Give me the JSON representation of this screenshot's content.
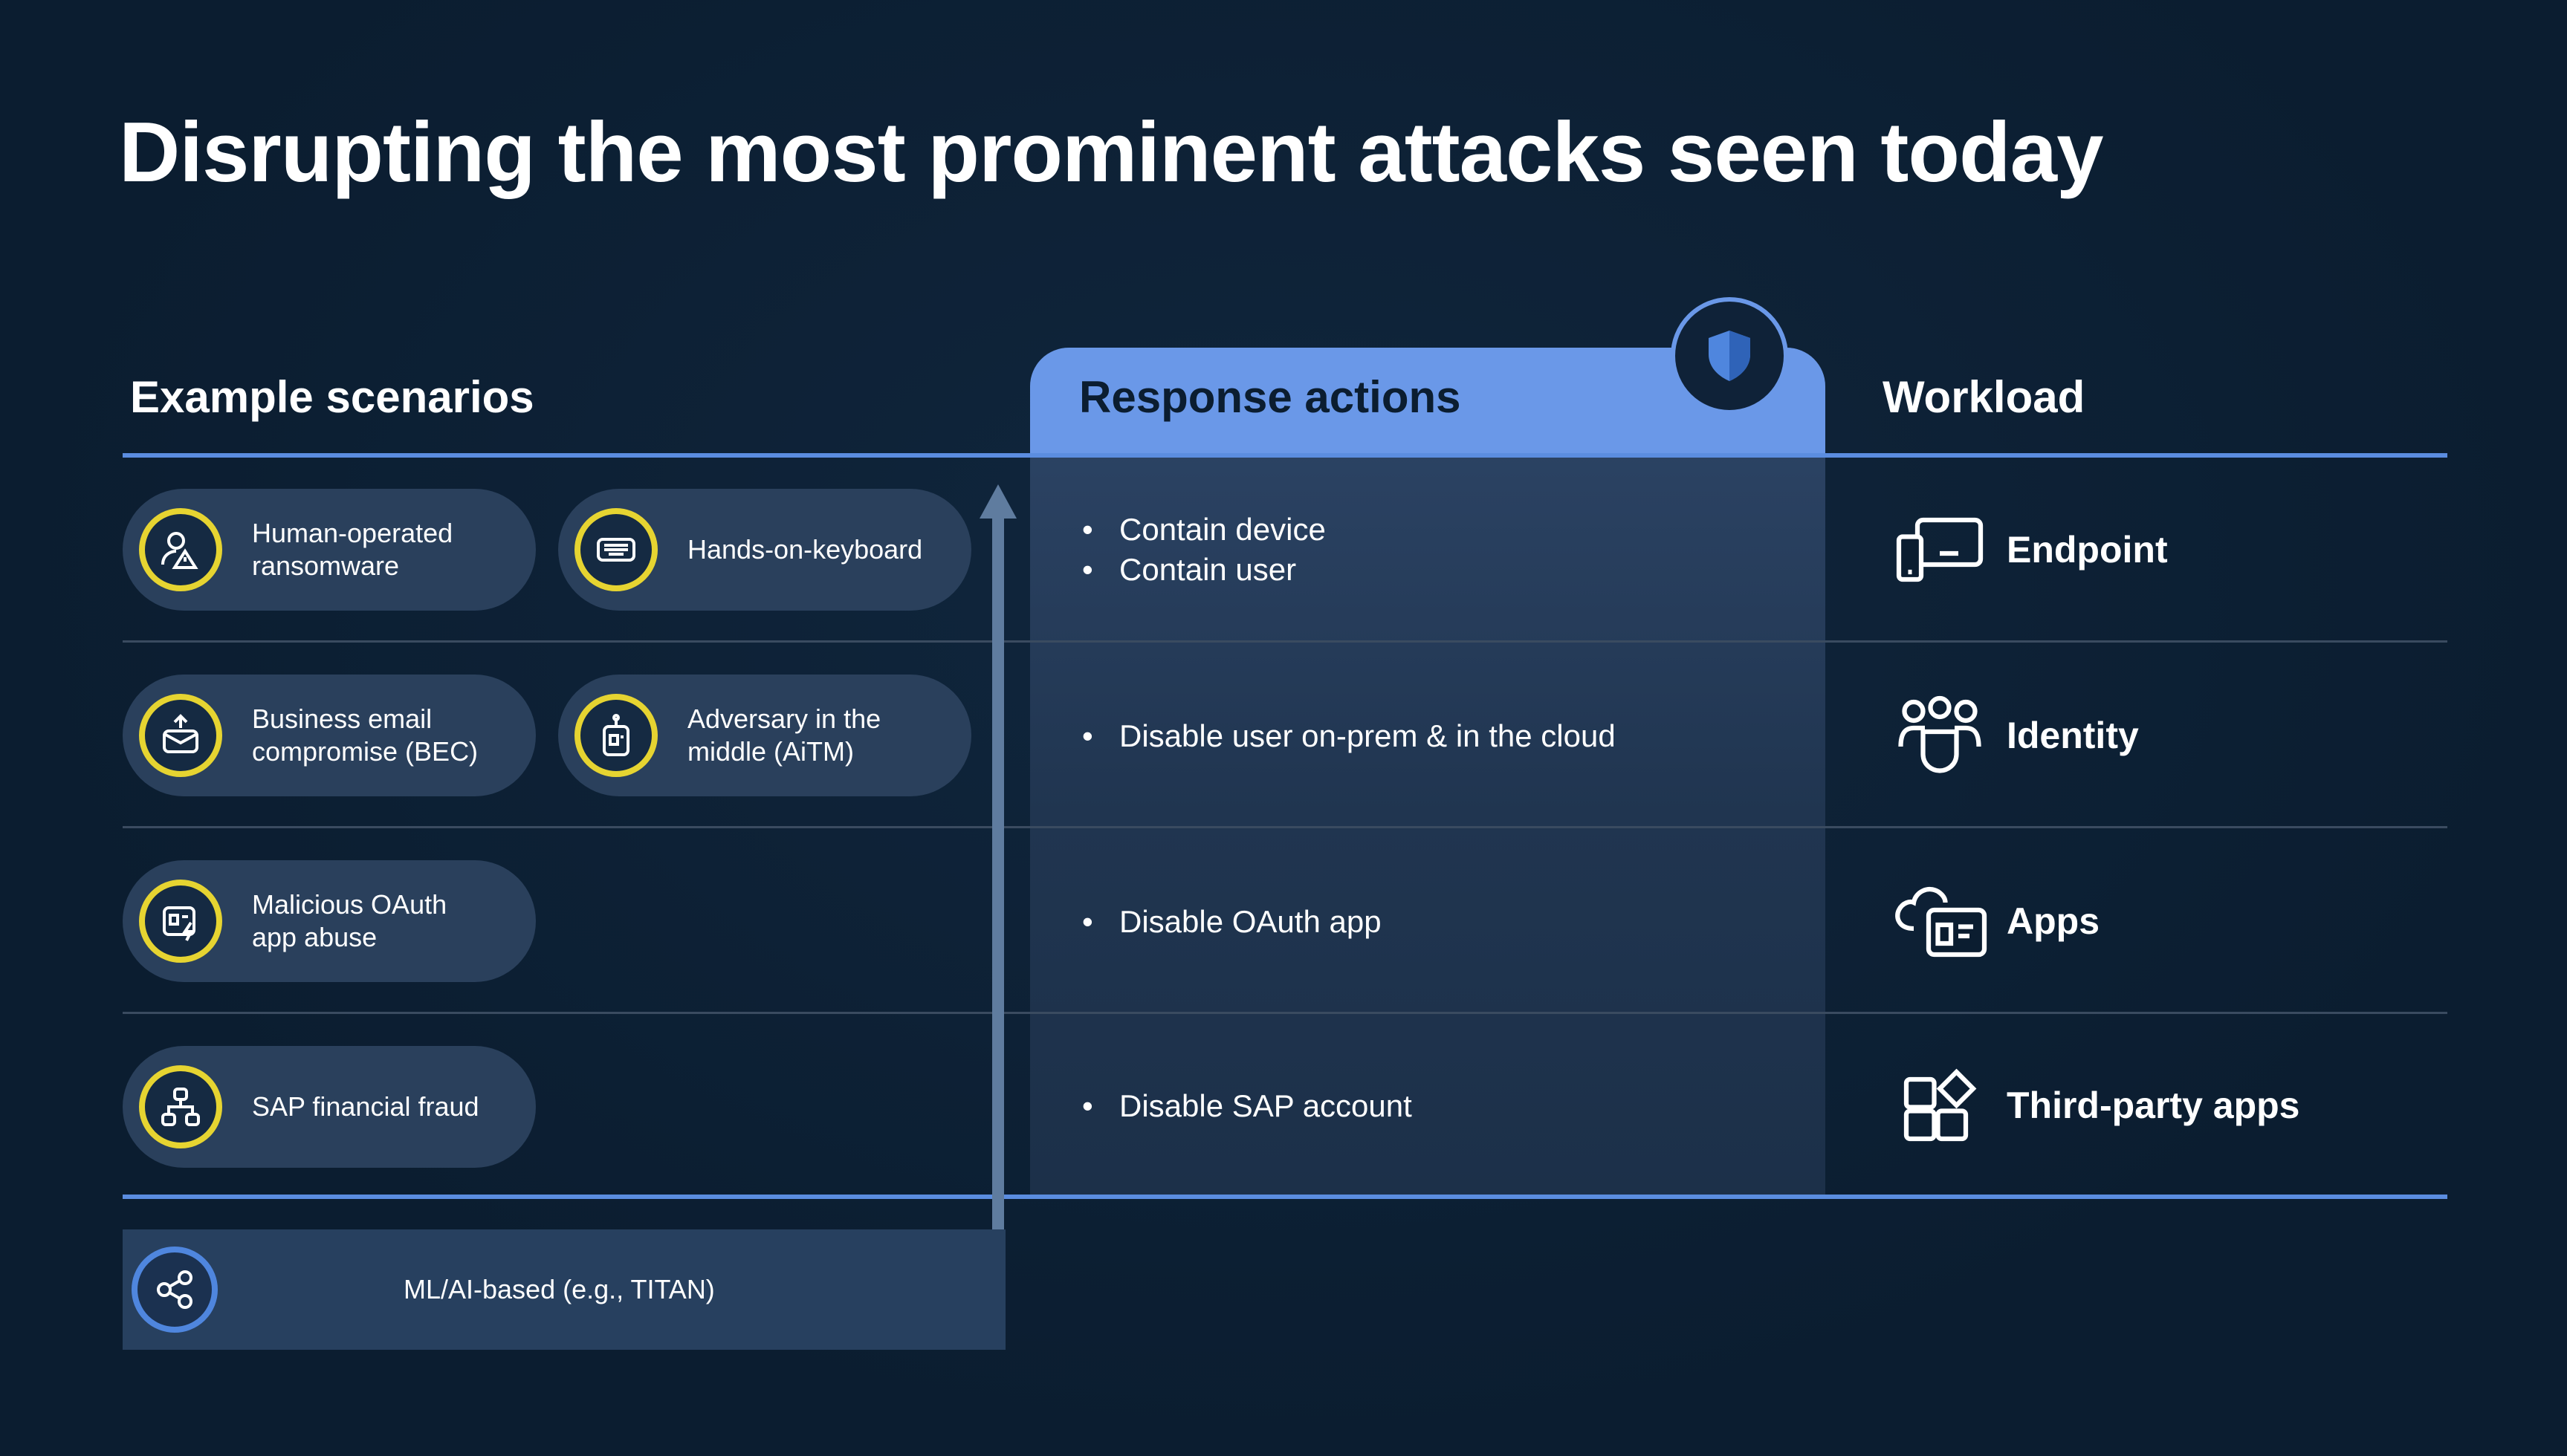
{
  "title": "Disrupting the most prominent attacks seen today",
  "columns": {
    "scenarios": "Example scenarios",
    "response": "Response actions",
    "workload": "Workload"
  },
  "scenarios": [
    {
      "label": "Human-operated ransomware",
      "icon": "user-warning-icon"
    },
    {
      "label": "Hands-on-keyboard",
      "icon": "keyboard-icon"
    },
    {
      "label": "Business email compromise (BEC)",
      "icon": "email-upload-icon"
    },
    {
      "label": "Adversary in the middle (AiTM)",
      "icon": "id-badge-icon"
    },
    {
      "label": "Malicious OAuth app abuse",
      "icon": "app-flash-icon"
    },
    {
      "label": "SAP financial fraud",
      "icon": "flow-diagram-icon"
    }
  ],
  "ml": {
    "label": "ML/AI-based (e.g., TITAN)",
    "icon": "share-nodes-icon"
  },
  "responses": [
    [
      "Contain device",
      "Contain user"
    ],
    [
      "Disable user on-prem & in the cloud"
    ],
    [
      "Disable OAuth app"
    ],
    [
      "Disable SAP account"
    ]
  ],
  "workloads": [
    {
      "label": "Endpoint",
      "icon": "devices-icon"
    },
    {
      "label": "Identity",
      "icon": "people-icon"
    },
    {
      "label": "Apps",
      "icon": "cloud-app-icon"
    },
    {
      "label": "Third-party apps",
      "icon": "apps-add-icon"
    }
  ],
  "colors": {
    "background": "#0b1d30",
    "accent_blue": "#6a98e8",
    "ring_yellow": "#e6d431",
    "pill": "#2a405c"
  }
}
